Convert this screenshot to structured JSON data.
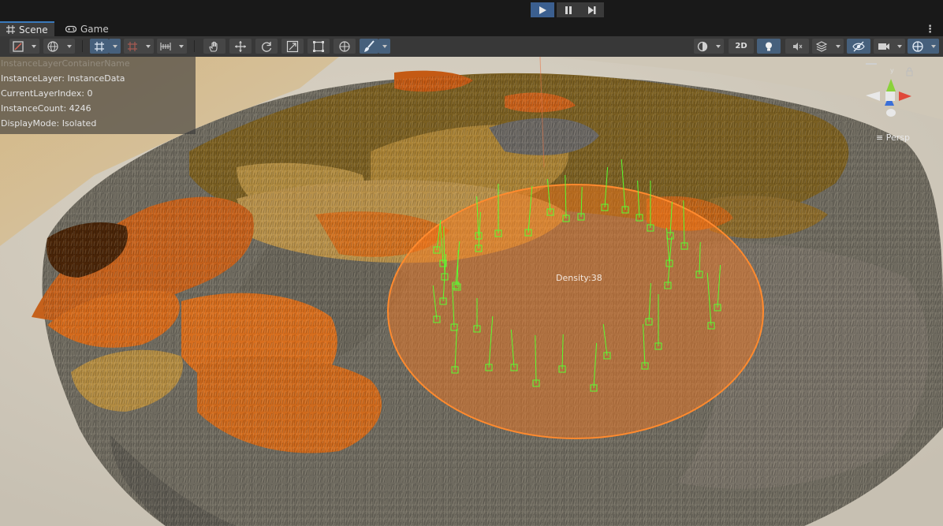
{
  "playbar": {
    "play_icon": "play-icon",
    "pause_icon": "pause-icon",
    "step_icon": "step-icon",
    "active": "play"
  },
  "tabs": [
    {
      "label": "Scene",
      "icon": "grid-icon",
      "active": true
    },
    {
      "label": "Game",
      "icon": "gamepad-icon",
      "active": false
    }
  ],
  "toolbar": {
    "left_tools": [
      "draw-mode-icon",
      "globe-icon",
      "grid-snap-icon",
      "increment-snap-icon",
      "ruler-icon"
    ],
    "transform_tools": [
      "hand-icon",
      "move-icon",
      "rotate-icon",
      "scale-icon",
      "rect-icon",
      "transform-icon",
      "brush-icon"
    ],
    "right_tools": [
      "shading-mode-icon",
      "lighting-icon",
      "audio-icon",
      "effects-icon",
      "visibility-icon",
      "camera-icon",
      "gizmos-icon"
    ],
    "mode_2d_label": "2D"
  },
  "overlay": {
    "faded_line": "InstanceLayerContainerName",
    "lines": [
      {
        "key": "InstanceLayer",
        "value": "InstanceData"
      },
      {
        "key": "CurrentLayerIndex",
        "value": "0"
      },
      {
        "key": "InstanceCount",
        "value": "4246"
      },
      {
        "key": "DisplayMode",
        "value": "Isolated"
      }
    ]
  },
  "brush": {
    "label": "Density:38",
    "color": "#ff7a1c"
  },
  "gizmo": {
    "axes": [
      "y",
      "x",
      "z"
    ],
    "projection_label": "Persp"
  },
  "colors": {
    "accent": "#3a79bb",
    "brush": "#ff7a1c",
    "instance_marker": "#59ff32"
  }
}
